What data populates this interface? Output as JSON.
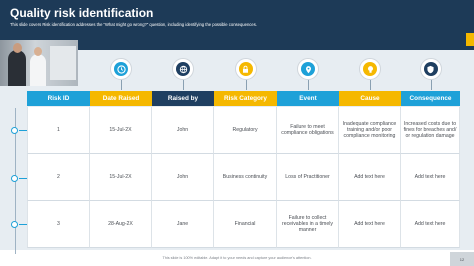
{
  "header": {
    "title": "Quality risk identification",
    "subtitle": "This slide covers Risk identification addresses the “What might go wrong?” question, including identifying the possible consequences."
  },
  "colors": {
    "header_bg": "#1d3a57",
    "accent": "#f5b800",
    "blue": "#1ea1d8",
    "yellow": "#f5b800",
    "dark_blue": "#1f3f61"
  },
  "icons": [
    {
      "name": "clock-icon",
      "color": "#1ea1d8"
    },
    {
      "name": "gear-globe-icon",
      "color": "#1f3f61"
    },
    {
      "name": "lock-gear-icon",
      "color": "#f5b800"
    },
    {
      "name": "location-pin-icon",
      "color": "#1ea1d8"
    },
    {
      "name": "lightbulb-icon",
      "color": "#f5b800"
    },
    {
      "name": "shield-icon",
      "color": "#1f3f61"
    }
  ],
  "table": {
    "columns": [
      {
        "label": "Risk ID",
        "color": "#1ea1d8"
      },
      {
        "label": "Date Raised",
        "color": "#f5b800"
      },
      {
        "label": "Raised by",
        "color": "#1f3f61"
      },
      {
        "label": "Risk Category",
        "color": "#f5b800"
      },
      {
        "label": "Event",
        "color": "#1ea1d8"
      },
      {
        "label": "Cause",
        "color": "#f5b800"
      },
      {
        "label": "Consequence",
        "color": "#1ea1d8"
      }
    ],
    "rows": [
      [
        "1",
        "15-Jul-2X",
        "John",
        "Regulatory",
        "Failure to meet compliance obligations",
        "Inadequate compliance training and/or poor compliance monitoring",
        "Increased costs due to fines for breaches and/ or regulation damage"
      ],
      [
        "2",
        "15-Jul-2X",
        "John",
        "Business continuity",
        "Loss of Practitioner",
        "Add text here",
        "Add text here"
      ],
      [
        "3",
        "28-Aug-2X",
        "Jane",
        "Financial",
        "Failure to collect receivables in a timely manner",
        "Add text here",
        "Add text here"
      ]
    ]
  },
  "footer": {
    "text": "This slide is 100% editable. Adapt it to your needs and capture your audience's attention.",
    "page": "12"
  }
}
